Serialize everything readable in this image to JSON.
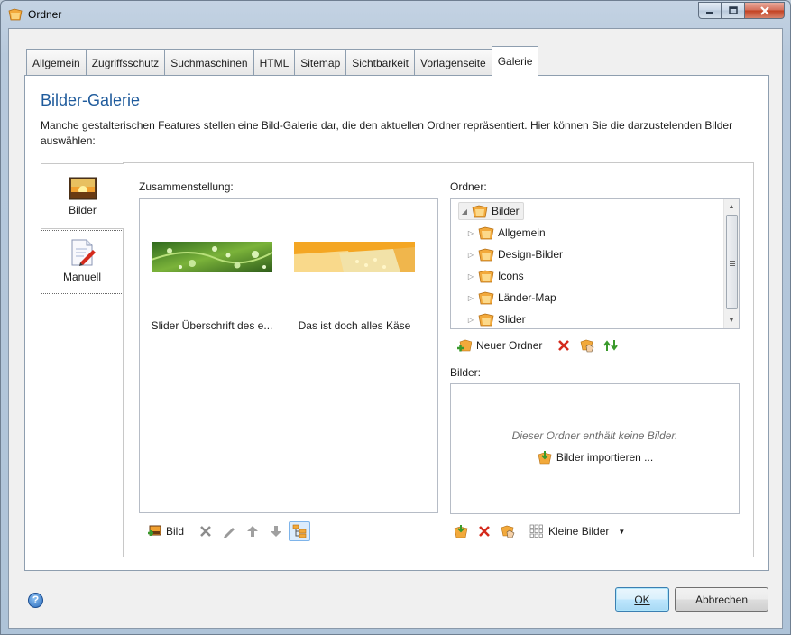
{
  "window": {
    "title": "Ordner"
  },
  "tabs": [
    {
      "label": "Allgemein",
      "active": false
    },
    {
      "label": "Zugriffsschutz",
      "active": false
    },
    {
      "label": "Suchmaschinen",
      "active": false
    },
    {
      "label": "HTML",
      "active": false
    },
    {
      "label": "Sitemap",
      "active": false
    },
    {
      "label": "Sichtbarkeit",
      "active": false
    },
    {
      "label": "Vorlagenseite",
      "active": false
    },
    {
      "label": "Galerie",
      "active": true
    }
  ],
  "page": {
    "title": "Bilder-Galerie",
    "description": "Manche gestalterischen Features stellen eine Bild-Galerie dar, die den aktuellen Ordner repräsentiert. Hier können Sie die darzustelenden Bilder auswählen:"
  },
  "side_tabs": [
    {
      "label": "Bilder",
      "icon": "picture-icon",
      "active": true
    },
    {
      "label": "Manuell",
      "icon": "document-edit-icon",
      "active": false
    }
  ],
  "composition": {
    "label": "Zusammenstellung:",
    "items": [
      {
        "caption": "Slider Überschrift des e...",
        "thumb": "leaf-with-water-drops"
      },
      {
        "caption": "Das ist doch alles Käse",
        "thumb": "cheese"
      }
    ],
    "toolbar": {
      "add_label": "Bild"
    }
  },
  "folders": {
    "label": "Ordner:",
    "root": "Bilder",
    "children": [
      "Allgemein",
      "Design-Bilder",
      "Icons",
      "Länder-Map",
      "Slider"
    ],
    "toolbar": {
      "new_folder_label": "Neuer Ordner"
    }
  },
  "images": {
    "label": "Bilder:",
    "empty_message": "Dieser Ordner enthält keine Bilder.",
    "import_label": "Bilder importieren ...",
    "toolbar": {
      "view_label": "Kleine Bilder"
    }
  },
  "footer": {
    "ok_label": "OK",
    "cancel_label": "Abbrechen"
  },
  "colors": {
    "title_blue": "#1f5b9c",
    "delete_red": "#d42a1c",
    "arrow_green": "#3a9a2c",
    "folder_orange": "#f2a93b"
  }
}
